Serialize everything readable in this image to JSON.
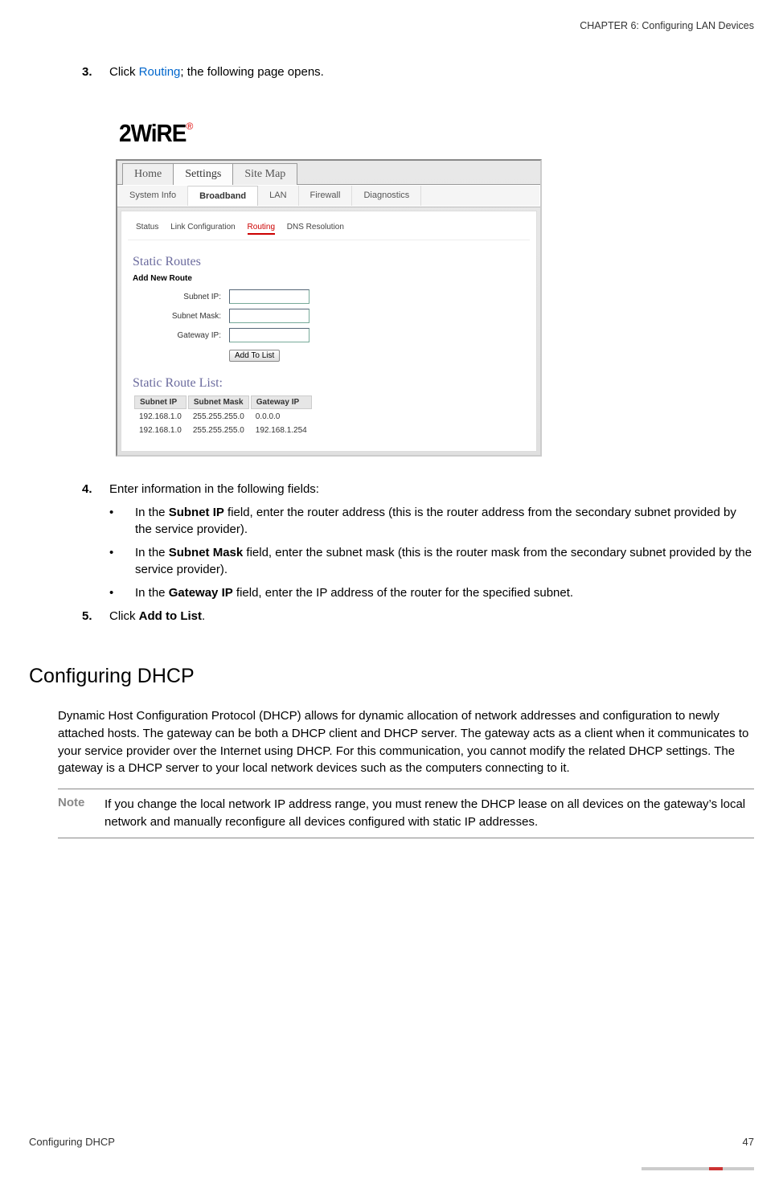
{
  "header": {
    "chapter": "CHAPTER 6: Configuring LAN Devices"
  },
  "step3": {
    "num": "3.",
    "pre": "Click ",
    "link": "Routing",
    "post": "; the following page opens."
  },
  "shot": {
    "logo": "2WiRE",
    "reg": "®",
    "topTabs": {
      "home": "Home",
      "settings": "Settings",
      "sitemap": "Site Map"
    },
    "subTabs": {
      "systeminfo": "System Info",
      "broadband": "Broadband",
      "lan": "LAN",
      "firewall": "Firewall",
      "diagnostics": "Diagnostics"
    },
    "minorTabs": {
      "status": "Status",
      "linkconfig": "Link Configuration",
      "routing": "Routing",
      "dns": "DNS Resolution"
    },
    "staticRoutes": "Static Routes",
    "addNewRoute": "Add New Route",
    "labels": {
      "subnetip": "Subnet IP:",
      "subnetmask": "Subnet Mask:",
      "gatewayip": "Gateway IP:"
    },
    "addBtn": "Add To List",
    "staticRouteList": "Static Route List:",
    "tableHdr": {
      "c1": "Subnet IP",
      "c2": "Subnet Mask",
      "c3": "Gateway IP"
    },
    "rows": [
      {
        "c1": "192.168.1.0",
        "c2": "255.255.255.0",
        "c3": "0.0.0.0"
      },
      {
        "c1": "192.168.1.0",
        "c2": "255.255.255.0",
        "c3": "192.168.1.254"
      }
    ]
  },
  "step4": {
    "num": "4.",
    "text": "Enter information in the following fields:",
    "b1a": "In the ",
    "b1b": "Subnet IP",
    "b1c": " field, enter the router address (this is the router address from the secondary subnet provided by the service provider).",
    "b2a": "In the ",
    "b2b": "Subnet Mask",
    "b2c": " field, enter the subnet mask (this is the router mask from the secondary subnet provided by the service provider).",
    "b3a": "In the ",
    "b3b": "Gateway IP",
    "b3c": " field, enter the IP address of the router for the specified subnet."
  },
  "step5": {
    "num": "5.",
    "pre": "Click ",
    "bold": "Add to List",
    "post": "."
  },
  "h2": "Configuring DHCP",
  "dhcpPara": "Dynamic Host Configuration Protocol (DHCP) allows for dynamic allocation of network addresses and configuration to newly attached hosts. The gateway can be both a DHCP client and DHCP server. The gateway acts as a client when it communicates to your service provider over the Internet using DHCP. For this communication, you cannot modify the related DHCP settings. The gateway is a DHCP server to your local network devices such as the computers connecting to it.",
  "note": {
    "label": "Note",
    "text": "If you change the local network IP address range, you must renew the DHCP lease on all devices on the gateway’s local network and manually reconfigure all devices configured with static IP addresses."
  },
  "footer": {
    "left": "Configuring DHCP",
    "right": "47"
  },
  "bulletChar": "•"
}
